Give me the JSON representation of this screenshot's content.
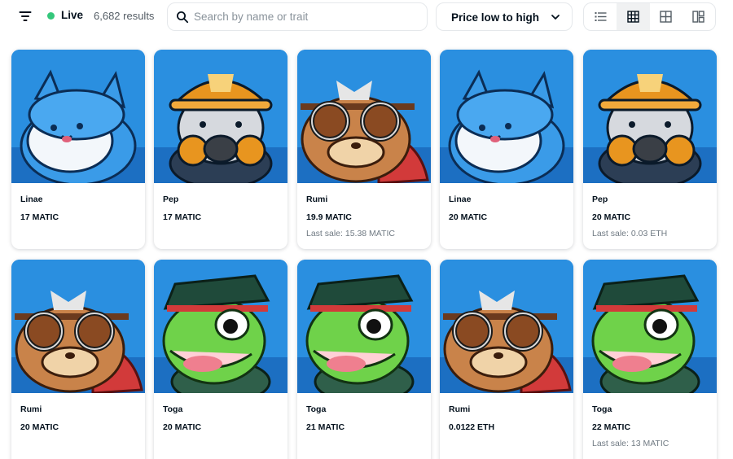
{
  "toolbar": {
    "live_label": "Live",
    "results": "6,682 results",
    "search_placeholder": "Search by name or trait",
    "sort_label": "Price low to high",
    "views": [
      "list-view-icon",
      "grid-view-icon",
      "large-grid-view-icon",
      "gallery-view-icon"
    ],
    "active_view": 1
  },
  "colors": {
    "accent": "#2081e2",
    "live": "#34c77b",
    "art_bg": "#2a8fe0"
  },
  "cards": [
    {
      "name": "Linae",
      "price": "17 MATIC",
      "last_sale": "",
      "character": "linae"
    },
    {
      "name": "Pep",
      "price": "17 MATIC",
      "last_sale": "",
      "character": "pep"
    },
    {
      "name": "Rumi",
      "price": "19.9 MATIC",
      "last_sale": "Last sale: 15.38 MATIC",
      "character": "rumi"
    },
    {
      "name": "Linae",
      "price": "20 MATIC",
      "last_sale": "",
      "character": "linae"
    },
    {
      "name": "Pep",
      "price": "20 MATIC",
      "last_sale": "Last sale: 0.03 ETH",
      "character": "pep"
    },
    {
      "name": "Rumi",
      "price": "20 MATIC",
      "last_sale": "",
      "character": "rumi"
    },
    {
      "name": "Toga",
      "price": "20 MATIC",
      "last_sale": "",
      "character": "toga"
    },
    {
      "name": "Toga",
      "price": "21 MATIC",
      "last_sale": "",
      "character": "toga"
    },
    {
      "name": "Rumi",
      "price": "0.0122 ETH",
      "last_sale": "",
      "character": "rumi"
    },
    {
      "name": "Toga",
      "price": "22 MATIC",
      "last_sale": "Last sale: 13 MATIC",
      "character": "toga"
    }
  ]
}
